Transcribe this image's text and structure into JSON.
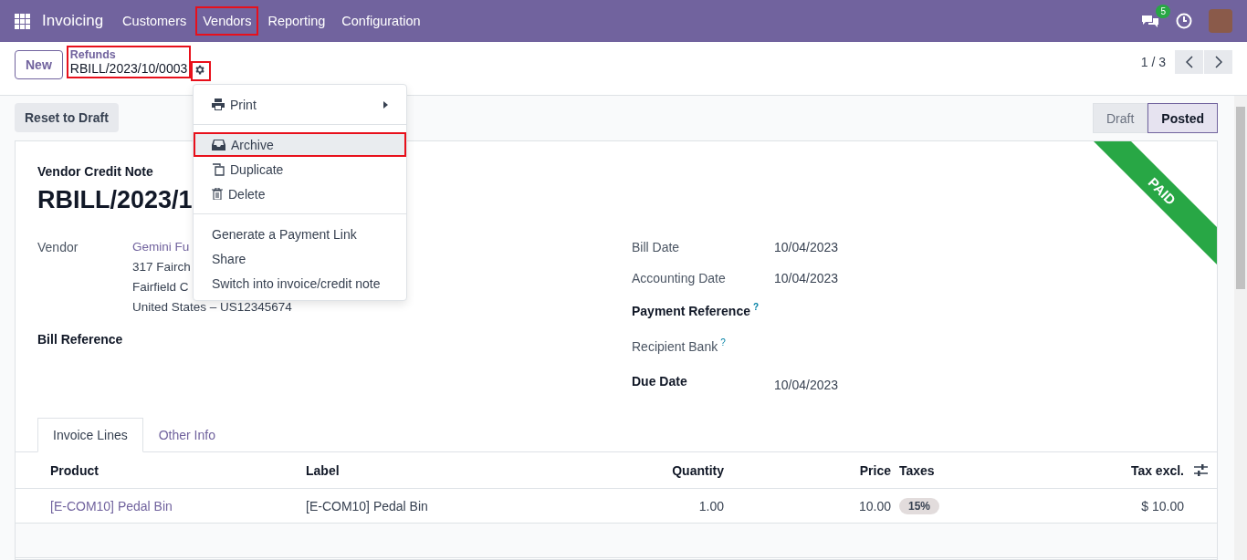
{
  "navbar": {
    "app": "Invoicing",
    "menu": [
      {
        "label": "Customers",
        "highlighted": false
      },
      {
        "label": "Vendors",
        "highlighted": true
      },
      {
        "label": "Reporting",
        "highlighted": false
      },
      {
        "label": "Configuration",
        "highlighted": false
      }
    ],
    "message_count": "5"
  },
  "control_panel": {
    "new_button": "New",
    "breadcrumb": {
      "parent": "Refunds",
      "current": "RBILL/2023/10/0003",
      "highlighted": true
    },
    "gear_highlighted": true,
    "pager": "1 / 3"
  },
  "action_menu": {
    "items": [
      {
        "label": "Print",
        "kind": "submenu",
        "highlighted": false,
        "selected": false
      },
      {
        "label": "Archive",
        "kind": "action",
        "highlighted": true,
        "selected": true
      },
      {
        "label": "Duplicate",
        "kind": "action",
        "highlighted": false,
        "selected": false
      },
      {
        "label": "Delete",
        "kind": "action",
        "highlighted": false,
        "selected": false
      },
      {
        "label": "Generate a Payment Link",
        "kind": "plain",
        "highlighted": false,
        "selected": false
      },
      {
        "label": "Share",
        "kind": "plain",
        "highlighted": false,
        "selected": false
      },
      {
        "label": "Switch into invoice/credit note",
        "kind": "plain",
        "highlighted": false,
        "selected": false
      }
    ]
  },
  "actions": {
    "buttons": [
      "Reset to Draft"
    ],
    "statuses": [
      {
        "label": "Draft",
        "selected": false
      },
      {
        "label": "Posted",
        "selected": true
      }
    ]
  },
  "sheet": {
    "ribbon": "PAID",
    "type": "Vendor Credit Note",
    "title": "RBILL/2023/1",
    "left_fields": [
      {
        "label": "Vendor",
        "link": "Gemini Fu",
        "lines": [
          "317 Fairch",
          "Fairfield C",
          "United States – US12345674"
        ],
        "bold": false
      },
      {
        "label": "Bill Reference",
        "bold": true
      }
    ],
    "right_fields": [
      {
        "label": "Bill Date",
        "value": "10/04/2023",
        "bold": false,
        "help": false
      },
      {
        "label": "Accounting Date",
        "value": "10/04/2023",
        "bold": false,
        "help": false
      },
      {
        "label": "Payment Reference",
        "bold": true,
        "help": true,
        "help_mark": "?"
      },
      {
        "label": "Recipient Bank",
        "bold": false,
        "help": true,
        "help_mark": "?"
      },
      {
        "label": "Due Date",
        "value": "10/04/2023",
        "bold": true,
        "help": false
      }
    ],
    "tabs": [
      {
        "label": "Invoice Lines",
        "selected": true
      },
      {
        "label": "Other Info",
        "selected": false
      }
    ],
    "table": {
      "columns": [
        "Product",
        "Label",
        "Quantity",
        "Price",
        "Taxes",
        "Tax excl."
      ],
      "rows": [
        {
          "product": "[E-COM10] Pedal Bin",
          "label": "[E-COM10] Pedal Bin",
          "quantity": "1.00",
          "price": "10.00",
          "taxes": "15%",
          "tax_excl": "$ 10.00"
        }
      ]
    }
  }
}
